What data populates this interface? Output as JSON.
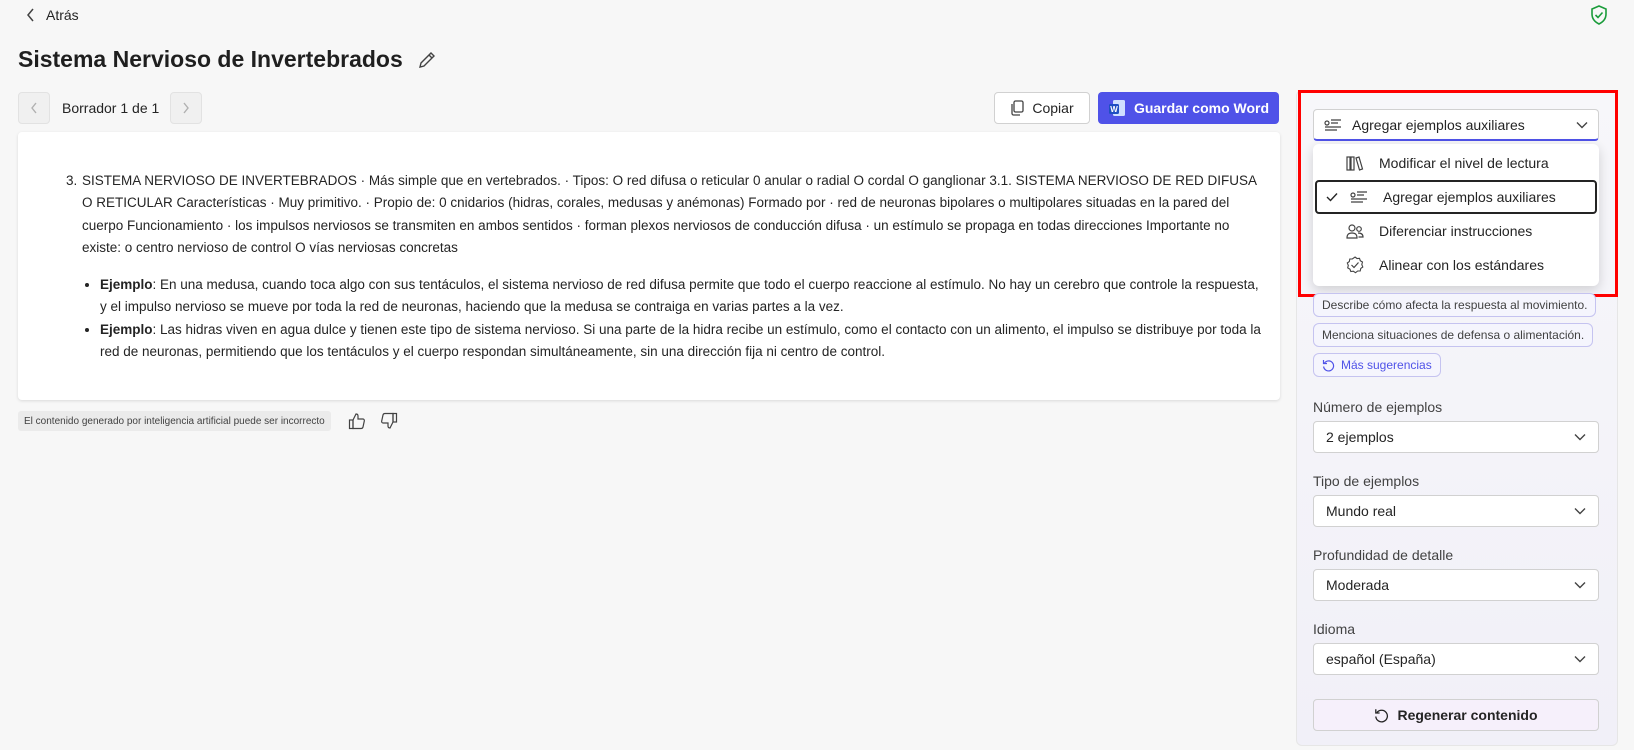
{
  "header": {
    "back_label": "Atrás"
  },
  "page": {
    "title": "Sistema Nervioso de Invertebrados"
  },
  "toolbar": {
    "draft_label": "Borrador 1 de 1",
    "copy_label": "Copiar",
    "save_word_label": "Guardar como Word"
  },
  "content": {
    "paragraph_number": "3.",
    "paragraph": "SISTEMA NERVIOSO DE INVERTEBRADOS · Más simple que en vertebrados. · Tipos: O red difusa o reticular 0 anular o radial O cordal O ganglionar 3.1. SISTEMA NERVIOSO DE RED DIFUSA O RETICULAR Características · Muy primitivo. · Propio de: 0 cnidarios (hidras, corales, medusas y anémonas) Formado por · red de neuronas bipolares o multipolares situadas en la pared del cuerpo Funcionamiento · los impulsos nerviosos se transmiten en ambos sentidos · forman plexos nerviosos de conducción difusa · un estímulo se propaga en todas direcciones Importante no existe: o centro nervioso de control O vías nerviosas concretas",
    "examples": [
      {
        "label": "Ejemplo",
        "text": ": En una medusa, cuando toca algo con sus tentáculos, el sistema nervioso de red difusa permite que todo el cuerpo reaccione al estímulo. No hay un cerebro que controle la respuesta, y el impulso nervioso se mueve por toda la red de neuronas, haciendo que la medusa se contraiga en varias partes a la vez."
      },
      {
        "label": "Ejemplo",
        "text": ": Las hidras viven en agua dulce y tienen este tipo de sistema nervioso. Si una parte de la hidra recibe un estímulo, como el contacto con un alimento, el impulso se distribuye por toda la red de neuronas, permitiendo que los tentáculos y el cuerpo respondan simultáneamente, sin una dirección fija ni centro de control."
      }
    ],
    "disclaimer": "El contenido generado por inteligencia artificial puede ser incorrecto"
  },
  "panel": {
    "action_select": "Agregar ejemplos auxiliares",
    "menu_items": [
      {
        "label": "Modificar el nivel de lectura",
        "icon": "books-icon"
      },
      {
        "label": "Agregar ejemplos auxiliares",
        "icon": "list-add-icon",
        "selected": true
      },
      {
        "label": "Diferenciar instrucciones",
        "icon": "people-icon"
      },
      {
        "label": "Alinear con los estándares",
        "icon": "badge-check-icon"
      }
    ],
    "suggestions": [
      "Describe cómo afecta la respuesta al movimiento.",
      "Menciona situaciones de defensa o alimentación."
    ],
    "more_suggestions": "Más sugerencias",
    "fields": {
      "num_examples_label": "Número de ejemplos",
      "num_examples_value": "2 ejemplos",
      "type_label": "Tipo de ejemplos",
      "type_value": "Mundo real",
      "depth_label": "Profundidad de detalle",
      "depth_value": "Moderada",
      "language_label": "Idioma",
      "language_value": "español (España)"
    },
    "regenerate_label": "Regenerar contenido"
  },
  "colors": {
    "accent": "#4f52e8",
    "highlight": "#ff0000",
    "shield": "#1a9c3a"
  }
}
